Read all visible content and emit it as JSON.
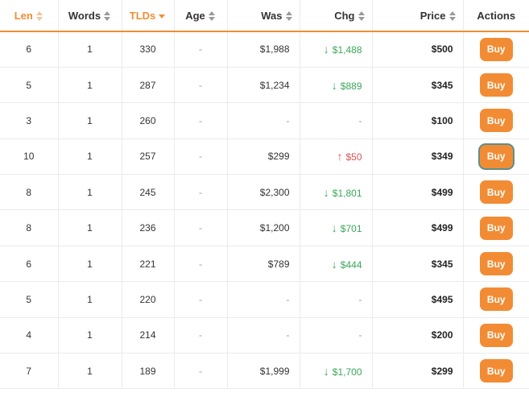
{
  "columns": {
    "len": "Len",
    "words": "Words",
    "tlds": "TLDs",
    "age": "Age",
    "was": "Was",
    "chg": "Chg",
    "price": "Price",
    "actions": "Actions"
  },
  "colors": {
    "accent": "#f28c34",
    "down": "#3aa757",
    "up": "#d9534f"
  },
  "buy_label": "Buy",
  "rows": [
    {
      "len": "6",
      "words": "1",
      "tlds": "330",
      "age": "-",
      "was": "$1,988",
      "chg": "$1,488",
      "dir": "down",
      "price": "$500"
    },
    {
      "len": "5",
      "words": "1",
      "tlds": "287",
      "age": "-",
      "was": "$1,234",
      "chg": "$889",
      "dir": "down",
      "price": "$345"
    },
    {
      "len": "3",
      "words": "1",
      "tlds": "260",
      "age": "-",
      "was": "-",
      "chg": "-",
      "dir": "none",
      "price": "$100"
    },
    {
      "len": "10",
      "words": "1",
      "tlds": "257",
      "age": "-",
      "was": "$299",
      "chg": "$50",
      "dir": "up",
      "price": "$349"
    },
    {
      "len": "8",
      "words": "1",
      "tlds": "245",
      "age": "-",
      "was": "$2,300",
      "chg": "$1,801",
      "dir": "down",
      "price": "$499"
    },
    {
      "len": "8",
      "words": "1",
      "tlds": "236",
      "age": "-",
      "was": "$1,200",
      "chg": "$701",
      "dir": "down",
      "price": "$499"
    },
    {
      "len": "6",
      "words": "1",
      "tlds": "221",
      "age": "-",
      "was": "$789",
      "chg": "$444",
      "dir": "down",
      "price": "$345"
    },
    {
      "len": "5",
      "words": "1",
      "tlds": "220",
      "age": "-",
      "was": "-",
      "chg": "-",
      "dir": "none",
      "price": "$495"
    },
    {
      "len": "4",
      "words": "1",
      "tlds": "214",
      "age": "-",
      "was": "-",
      "chg": "-",
      "dir": "none",
      "price": "$200"
    },
    {
      "len": "7",
      "words": "1",
      "tlds": "189",
      "age": "-",
      "was": "$1,999",
      "chg": "$1,700",
      "dir": "down",
      "price": "$299"
    }
  ]
}
